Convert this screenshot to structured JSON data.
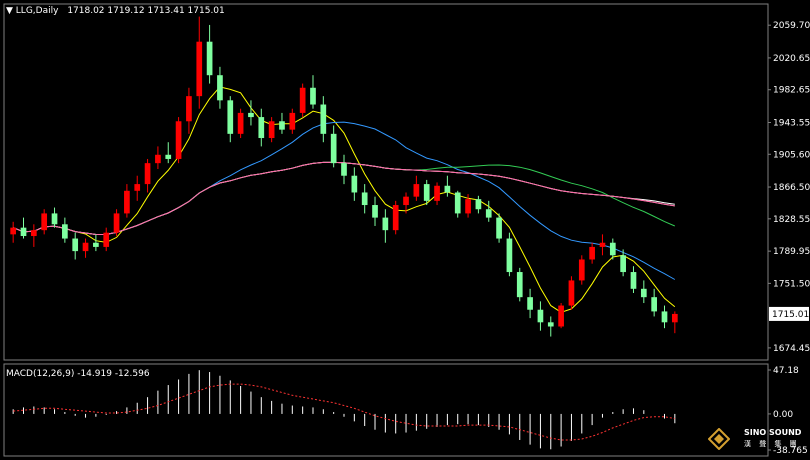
{
  "header": {
    "symbol": "LLG,Daily",
    "ohlc": "1718.02 1719.12 1713.41 1715.01",
    "macd_label": "MACD(12,26,9) -14.919 -12.596"
  },
  "logo": {
    "name": "SINO SOUND",
    "sub": "漢 聲 集 團"
  },
  "colors": {
    "background": "#000000",
    "up": "#ff0000",
    "down": "#7fffa0",
    "ma5": "#ffff00",
    "ma20": "#3399ff",
    "ma40": "#33cc55",
    "ma60": "#ffffff",
    "ma120": "#d8c8a0",
    "ma250": "#ff66aa"
  },
  "chart_data": [
    {
      "type": "candlestick",
      "ylim": [
        1660,
        2085
      ],
      "yticks": [
        "2059.70",
        "2020.65",
        "1982.65",
        "1943.55",
        "1905.60",
        "1866.50",
        "1828.55",
        "1789.95",
        "1751.50",
        "1715.01",
        "1674.45"
      ],
      "last_price": "1715.01",
      "candles": [
        [
          1810,
          1825,
          1800,
          1818
        ],
        [
          1818,
          1830,
          1805,
          1808
        ],
        [
          1808,
          1822,
          1795,
          1815
        ],
        [
          1815,
          1840,
          1810,
          1835
        ],
        [
          1835,
          1842,
          1818,
          1822
        ],
        [
          1822,
          1830,
          1800,
          1805
        ],
        [
          1805,
          1812,
          1780,
          1790
        ],
        [
          1790,
          1805,
          1782,
          1800
        ],
        [
          1800,
          1810,
          1790,
          1795
        ],
        [
          1795,
          1818,
          1790,
          1812
        ],
        [
          1812,
          1840,
          1808,
          1835
        ],
        [
          1835,
          1870,
          1830,
          1862
        ],
        [
          1862,
          1880,
          1850,
          1870
        ],
        [
          1870,
          1900,
          1860,
          1895
        ],
        [
          1895,
          1915,
          1888,
          1905
        ],
        [
          1905,
          1920,
          1895,
          1900
        ],
        [
          1900,
          1950,
          1895,
          1945
        ],
        [
          1945,
          1985,
          1930,
          1975
        ],
        [
          1975,
          2070,
          1960,
          2040
        ],
        [
          2040,
          2060,
          1990,
          2000
        ],
        [
          2000,
          2010,
          1960,
          1970
        ],
        [
          1970,
          1975,
          1920,
          1930
        ],
        [
          1930,
          1960,
          1925,
          1955
        ],
        [
          1955,
          1970,
          1940,
          1950
        ],
        [
          1950,
          1960,
          1915,
          1925
        ],
        [
          1925,
          1950,
          1920,
          1945
        ],
        [
          1945,
          1955,
          1930,
          1935
        ],
        [
          1935,
          1960,
          1930,
          1955
        ],
        [
          1955,
          1990,
          1950,
          1985
        ],
        [
          1985,
          2000,
          1960,
          1965
        ],
        [
          1965,
          1975,
          1920,
          1930
        ],
        [
          1930,
          1940,
          1890,
          1895
        ],
        [
          1895,
          1905,
          1870,
          1880
        ],
        [
          1880,
          1890,
          1850,
          1860
        ],
        [
          1860,
          1870,
          1835,
          1845
        ],
        [
          1845,
          1855,
          1820,
          1830
        ],
        [
          1830,
          1840,
          1800,
          1815
        ],
        [
          1815,
          1850,
          1810,
          1845
        ],
        [
          1845,
          1860,
          1835,
          1855
        ],
        [
          1855,
          1880,
          1850,
          1870
        ],
        [
          1870,
          1875,
          1845,
          1850
        ],
        [
          1850,
          1872,
          1845,
          1868
        ],
        [
          1868,
          1880,
          1855,
          1860
        ],
        [
          1860,
          1862,
          1830,
          1835
        ],
        [
          1835,
          1858,
          1830,
          1852
        ],
        [
          1852,
          1856,
          1835,
          1840
        ],
        [
          1840,
          1850,
          1825,
          1830
        ],
        [
          1830,
          1835,
          1800,
          1805
        ],
        [
          1805,
          1812,
          1760,
          1765
        ],
        [
          1765,
          1770,
          1730,
          1735
        ],
        [
          1735,
          1745,
          1710,
          1720
        ],
        [
          1720,
          1730,
          1695,
          1705
        ],
        [
          1705,
          1712,
          1688,
          1700
        ],
        [
          1700,
          1728,
          1698,
          1725
        ],
        [
          1725,
          1760,
          1720,
          1755
        ],
        [
          1755,
          1785,
          1750,
          1780
        ],
        [
          1780,
          1800,
          1775,
          1795
        ],
        [
          1795,
          1810,
          1785,
          1800
        ],
        [
          1800,
          1805,
          1780,
          1785
        ],
        [
          1785,
          1792,
          1760,
          1765
        ],
        [
          1765,
          1772,
          1740,
          1745
        ],
        [
          1745,
          1755,
          1728,
          1735
        ],
        [
          1735,
          1745,
          1712,
          1718
        ],
        [
          1718,
          1725,
          1698,
          1705
        ],
        [
          1705,
          1718,
          1692,
          1715
        ]
      ],
      "ma_periods": [
        5,
        20,
        40,
        60,
        120,
        250
      ]
    },
    {
      "type": "bar",
      "series": [
        {
          "name": "MACD(12,26,9)"
        }
      ],
      "ylim": [
        -38.765,
        47.18
      ],
      "yticks": [
        "47.18",
        "0.00",
        "-38.765"
      ],
      "values": [
        5,
        7,
        8,
        7,
        5,
        2,
        -2,
        -4,
        -3,
        -1,
        3,
        7,
        12,
        18,
        25,
        31,
        37,
        43,
        47,
        45,
        41,
        36,
        30,
        24,
        18,
        14,
        11,
        9,
        8,
        7,
        5,
        2,
        -3,
        -8,
        -13,
        -17,
        -20,
        -21,
        -20,
        -18,
        -16,
        -14,
        -12,
        -11,
        -11,
        -12,
        -14,
        -17,
        -22,
        -28,
        -33,
        -37,
        -38,
        -35,
        -29,
        -21,
        -12,
        -4,
        2,
        5,
        6,
        4,
        0,
        -5,
        -10
      ],
      "signal": [
        3,
        4,
        5,
        6,
        6,
        5,
        4,
        3,
        2,
        1,
        1,
        2,
        4,
        6,
        9,
        13,
        17,
        21,
        25,
        29,
        31,
        32,
        32,
        31,
        29,
        26,
        23,
        20,
        18,
        16,
        14,
        12,
        9,
        6,
        2,
        -2,
        -5,
        -8,
        -10,
        -12,
        -13,
        -13,
        -13,
        -13,
        -12,
        -12,
        -12,
        -13,
        -14,
        -17,
        -20,
        -23,
        -26,
        -28,
        -28,
        -27,
        -24,
        -20,
        -15,
        -11,
        -7,
        -4,
        -3,
        -3,
        -5
      ]
    }
  ]
}
